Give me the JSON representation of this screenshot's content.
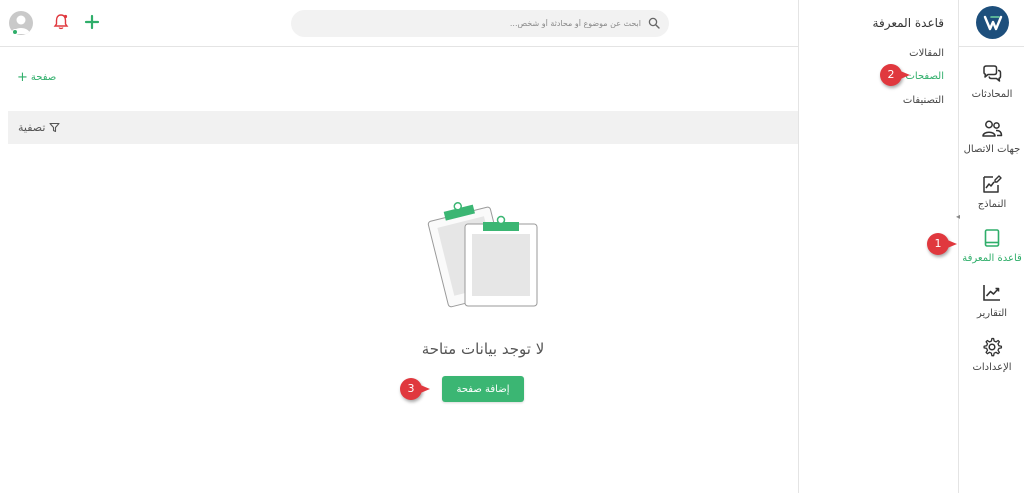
{
  "header": {
    "search_placeholder": "ابحث عن موضوع أو محادثة أو شخص..."
  },
  "rail": {
    "items": [
      {
        "label": "المحادثات",
        "icon": "chat-bubbles-icon"
      },
      {
        "label": "جهات الاتصال",
        "icon": "contacts-icon"
      },
      {
        "label": "النماذج",
        "icon": "form-edit-icon"
      },
      {
        "label": "قاعدة المعرفة",
        "icon": "book-icon",
        "active": true
      },
      {
        "label": "التقارير",
        "icon": "chart-line-icon"
      },
      {
        "label": "الإعدادات",
        "icon": "gear-icon"
      }
    ]
  },
  "panel": {
    "title": "قاعدة المعرفة",
    "items": [
      {
        "label": "المقالات"
      },
      {
        "label": "الصفحات",
        "active": true
      },
      {
        "label": "التصنيفات"
      }
    ]
  },
  "main": {
    "add_page_label": "صفحة",
    "filter_label": "تصفية",
    "empty_message": "لا توجد بيانات متاحة",
    "add_page_button": "إضافة صفحة"
  },
  "annotations": [
    "1",
    "2",
    "3"
  ],
  "colors": {
    "accent": "#2fae6a",
    "button": "#3bb673",
    "callout": "#e0383e",
    "logo": "#1d4f7c"
  }
}
